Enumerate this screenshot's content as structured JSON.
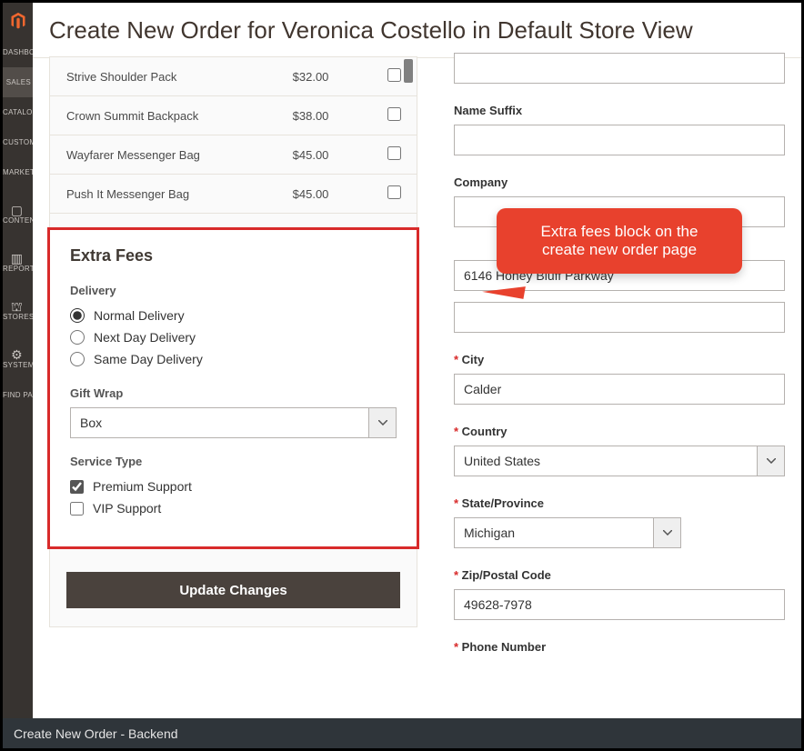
{
  "sidebar": {
    "items": [
      "DASHBOARD",
      "SALES",
      "CATALOG",
      "CUSTOMERS",
      "MARKETING",
      "CONTENT",
      "REPORTS",
      "STORES",
      "SYSTEM",
      "FIND PARTNERS & EXTENSIONS"
    ]
  },
  "header": {
    "title": "Create New Order for Veronica Costello in Default Store View"
  },
  "products": [
    {
      "name": "Strive Shoulder Pack",
      "price": "$32.00"
    },
    {
      "name": "Crown Summit Backpack",
      "price": "$38.00"
    },
    {
      "name": "Wayfarer Messenger Bag",
      "price": "$45.00"
    },
    {
      "name": "Push It Messenger Bag",
      "price": "$45.00"
    }
  ],
  "extra_fees": {
    "title": "Extra Fees",
    "delivery": {
      "label": "Delivery",
      "options": [
        "Normal Delivery",
        "Next Day Delivery",
        "Same Day Delivery"
      ],
      "selected": 0
    },
    "gift_wrap": {
      "label": "Gift Wrap",
      "value": "Box"
    },
    "service_type": {
      "label": "Service Type",
      "options": [
        {
          "label": "Premium Support",
          "checked": true
        },
        {
          "label": "VIP Support",
          "checked": false
        }
      ]
    }
  },
  "update_label": "Update Changes",
  "form": {
    "name_suffix": {
      "label": "Name Suffix",
      "value": ""
    },
    "company": {
      "label": "Company",
      "value": ""
    },
    "street": {
      "value": "6146 Honey Bluff Parkway"
    },
    "street2": {
      "value": ""
    },
    "city": {
      "label": "City",
      "value": "Calder"
    },
    "country": {
      "label": "Country",
      "value": "United States"
    },
    "state": {
      "label": "State/Province",
      "value": "Michigan"
    },
    "zip": {
      "label": "Zip/Postal Code",
      "value": "49628-7978"
    },
    "phone": {
      "label": "Phone Number"
    }
  },
  "callout": {
    "line1": "Extra fees block on the",
    "line2": "create new order page"
  },
  "caption": "Create New Order - Backend"
}
